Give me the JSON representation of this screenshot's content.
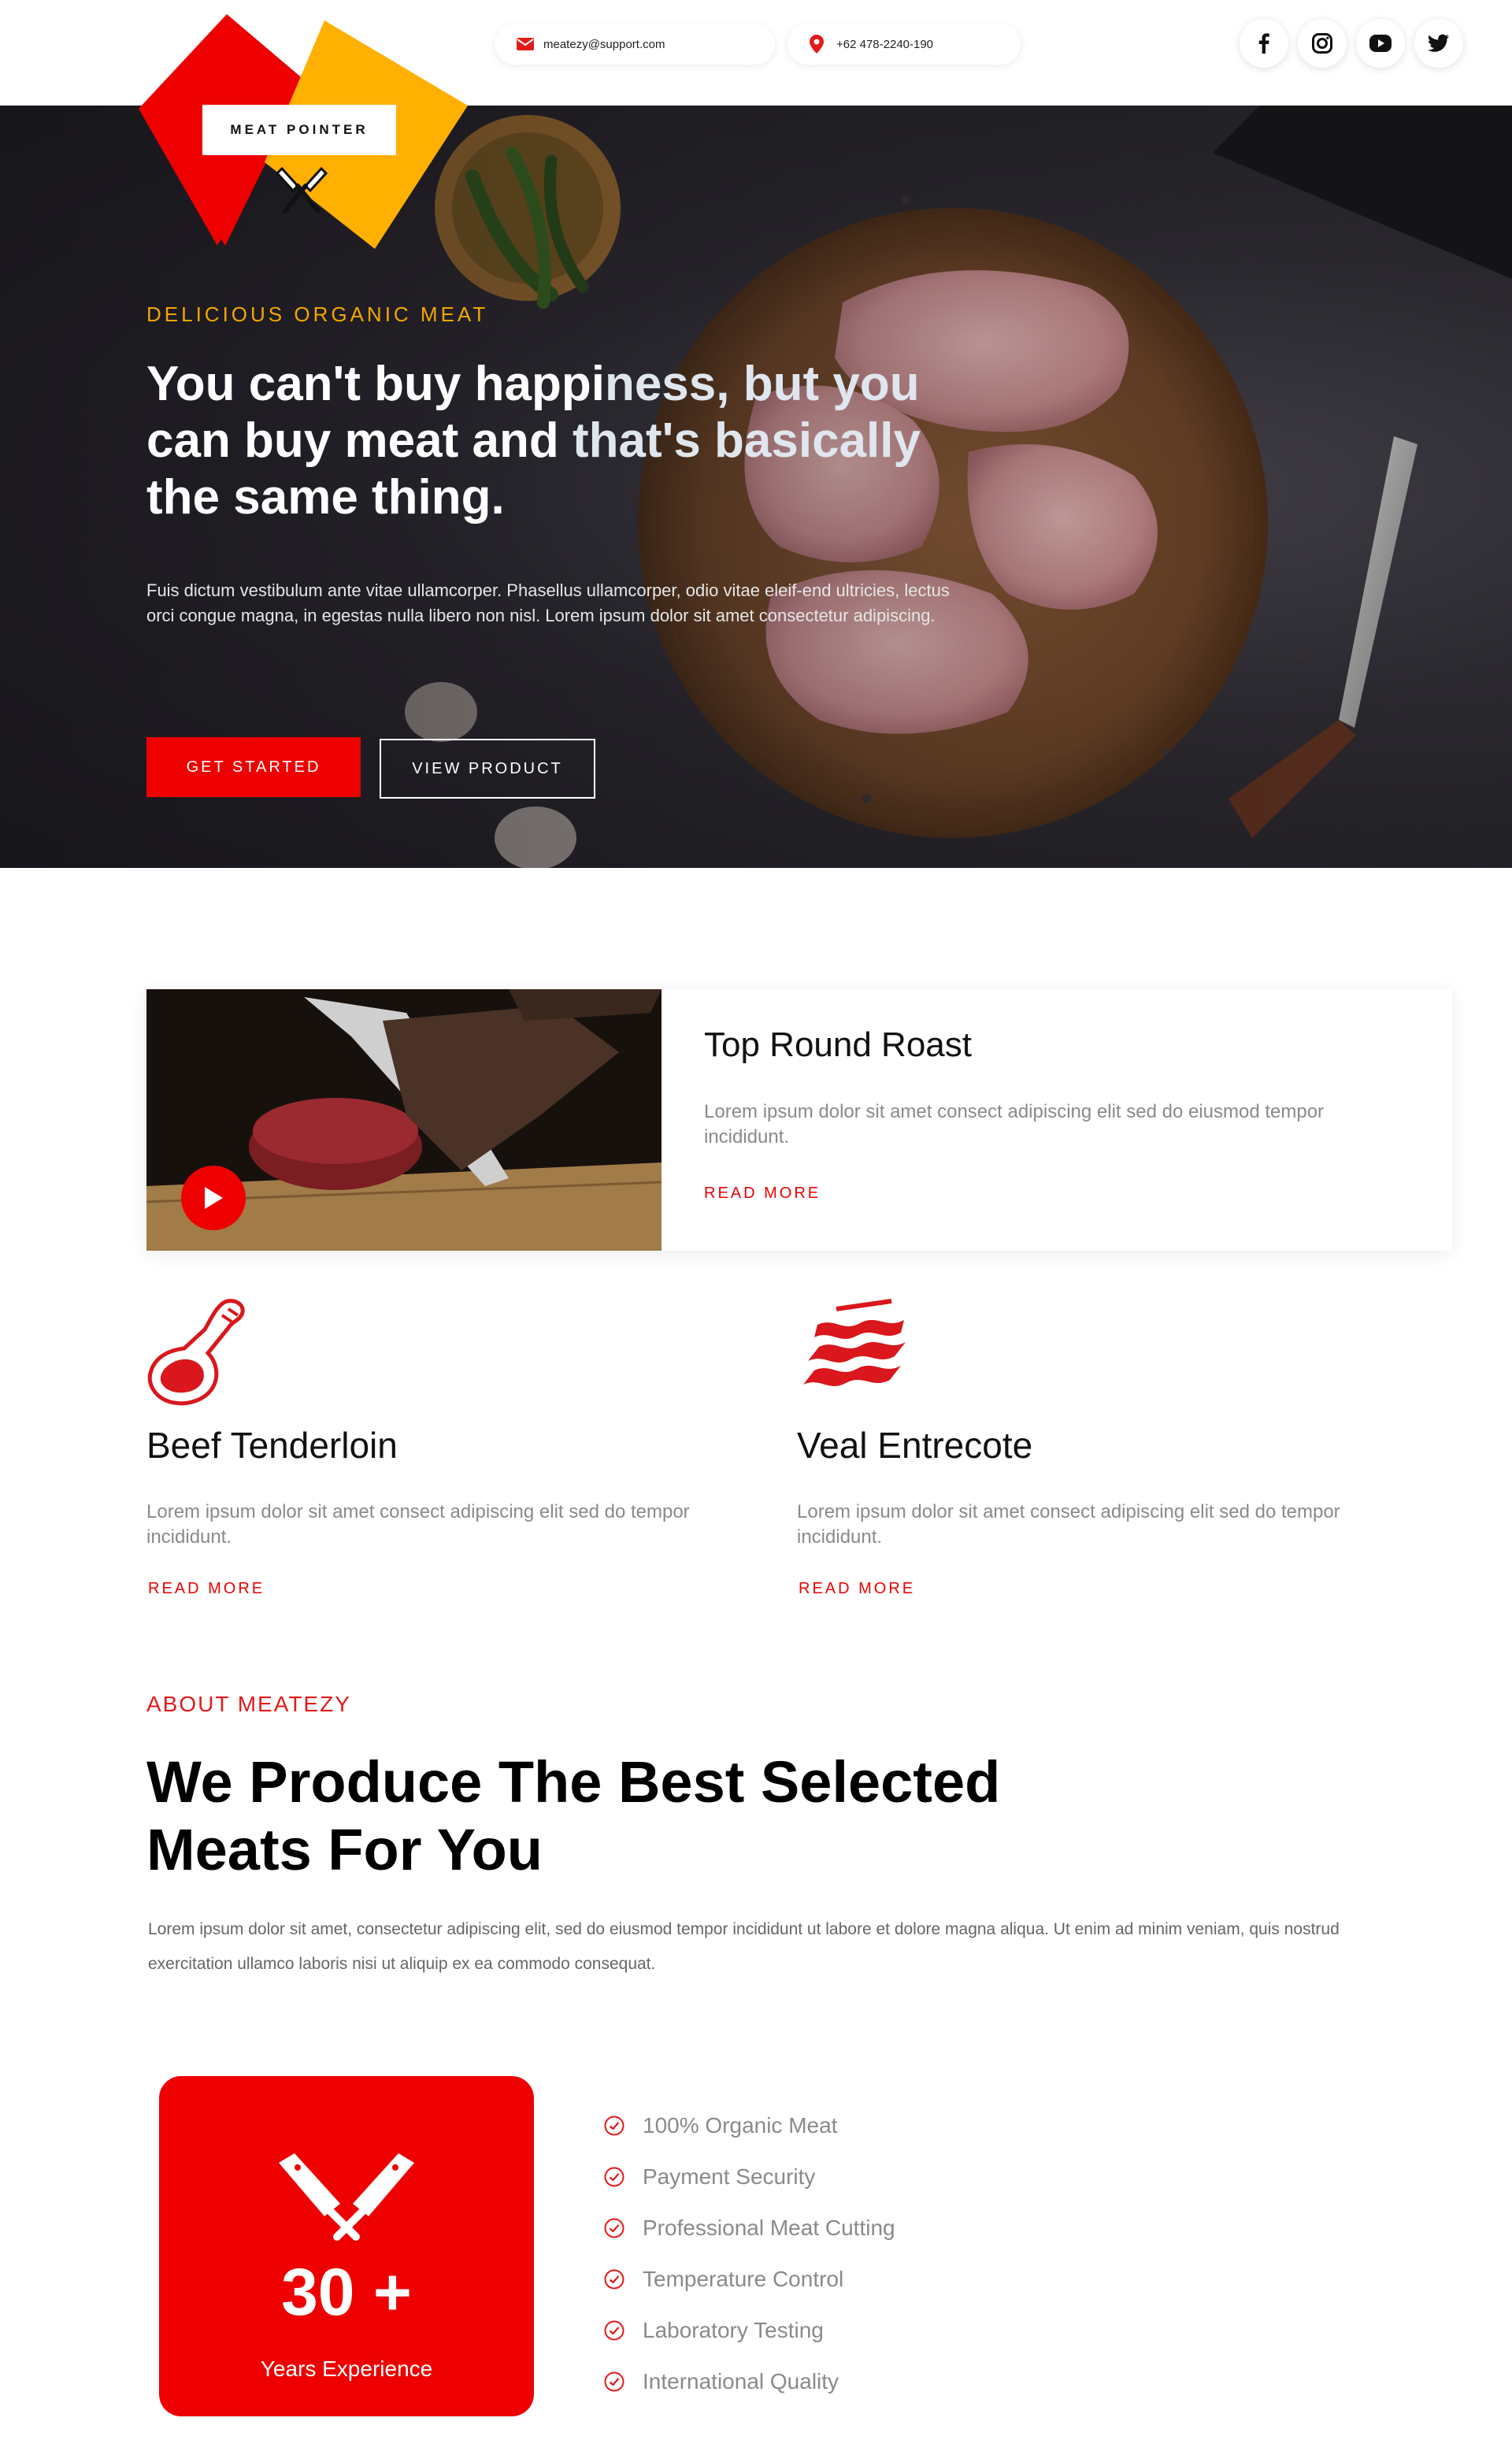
{
  "contact": {
    "email": "meatezy@support.com",
    "phone": "+62 478-2240-190"
  },
  "socials": [
    {
      "name": "facebook-icon"
    },
    {
      "name": "instagram-icon"
    },
    {
      "name": "youtube-icon"
    },
    {
      "name": "twitter-icon"
    }
  ],
  "logo": {
    "text": "MEAT POINTER",
    "colors": {
      "red": "#ee0000",
      "yellow": "#ffb000"
    }
  },
  "hero": {
    "eyebrow": "DELICIOUS ORGANIC MEAT",
    "title_a": "You can't buy happi",
    "title_b": "ness, but you",
    "title_c": "can buy meat and ",
    "title_d": "that's basically",
    "title_e": "the same thing.",
    "text": "Fuis dictum vestibulum ante vitae ullamcorper. Phasellus ullamcorper, odio vitae eleif-end ultricies, lectus orci congue magna, in egestas nulla libero non nisl. Lorem ipsum dolor sit amet consectetur adipiscing.",
    "cta_primary": "GET STARTED",
    "cta_secondary": "VIEW PRODUCT"
  },
  "feature": {
    "title": "Top Round Roast",
    "text": "Lorem ipsum dolor sit amet consect adipiscing elit sed do eiusmod tempor incididunt.",
    "link": "READ MORE"
  },
  "products": [
    {
      "title": "Beef Tenderloin",
      "text": "Lorem ipsum dolor sit amet consect adipiscing elit sed do tempor incididunt.",
      "link": "READ MORE"
    },
    {
      "title": "Veal Entrecote",
      "text": "Lorem ipsum dolor sit amet consect adipiscing elit sed do tempor incididunt.",
      "link": "READ MORE"
    }
  ],
  "about": {
    "eyebrow": "ABOUT MEATEZY",
    "title_line1": "We Produce The Best Selected",
    "title_line2": "Meats For You",
    "text": "Lorem ipsum dolor sit amet, consectetur adipiscing elit, sed do eiusmod tempor incididunt ut labore et dolore magna aliqua. Ut enim ad minim veniam, quis nostrud exercitation ullamco laboris nisi ut aliquip ex ea commodo consequat."
  },
  "experience": {
    "number": "30 +",
    "label": "Years Experience"
  },
  "features_list": [
    "100% Organic Meat",
    "Payment Security",
    "Professional Meat Cutting",
    "Temperature Control",
    "Laboratory Testing",
    "International Quality"
  ],
  "accent_color": "#ee0000"
}
